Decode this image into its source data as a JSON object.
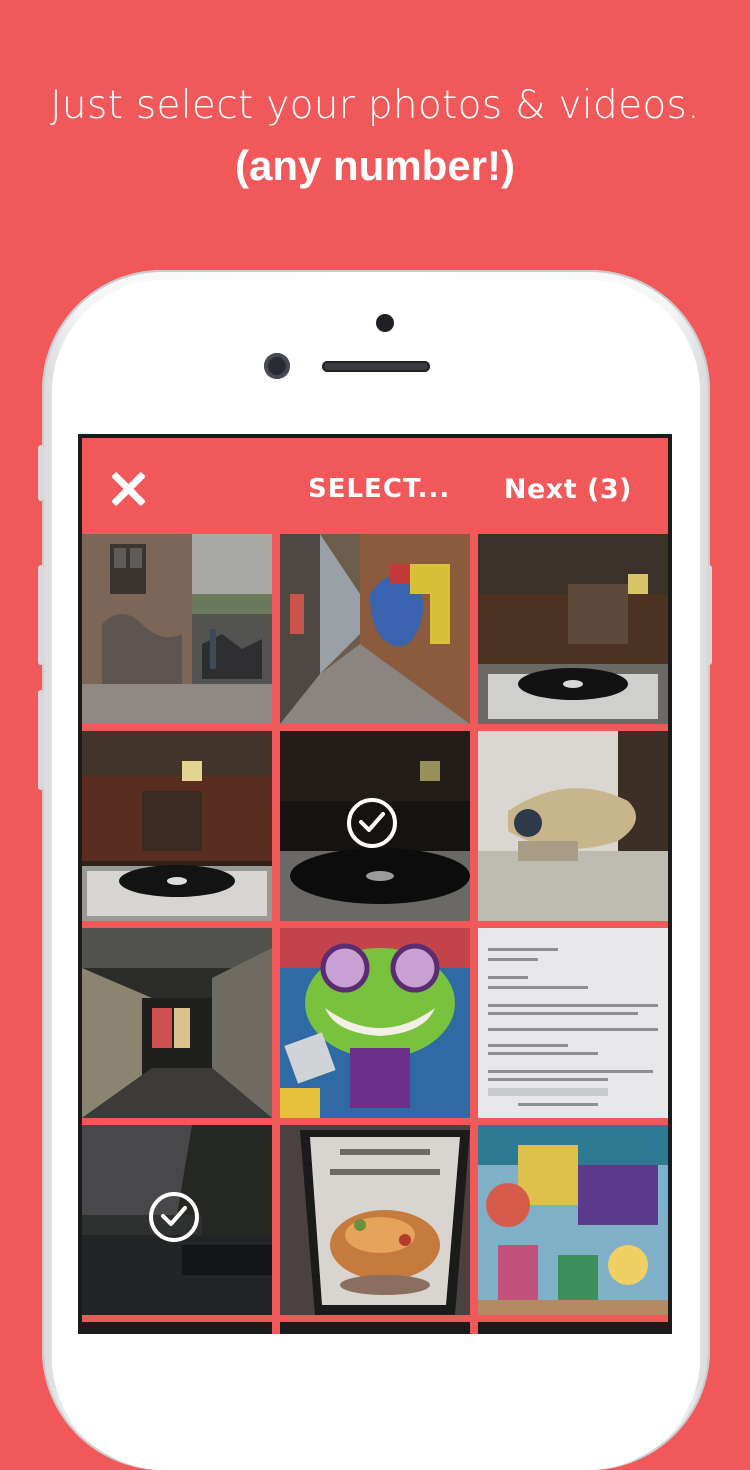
{
  "headline": {
    "line1": "Just select your photos & videos.",
    "line2": "(any number!)"
  },
  "colors": {
    "accent": "#f0585a",
    "text": "#ffffff"
  },
  "app": {
    "close_icon": "close-icon",
    "title": "SELECT...",
    "next_label": "Next (3)"
  },
  "photos": [
    {
      "subject": "brick alley with bicycles",
      "selected": false
    },
    {
      "subject": "graffiti alley",
      "selected": false
    },
    {
      "subject": "bar with turntable",
      "selected": false
    },
    {
      "subject": "bar interior with turntable",
      "selected": false
    },
    {
      "subject": "turntable close-up",
      "selected": true
    },
    {
      "subject": "millennium falcon model",
      "selected": false
    },
    {
      "subject": "underground arcade",
      "selected": false
    },
    {
      "subject": "green frog graffiti",
      "selected": false
    },
    {
      "subject": "screenshot of document",
      "selected": false
    },
    {
      "subject": "canal with boat",
      "selected": true
    },
    {
      "subject": "food poster",
      "selected": false
    },
    {
      "subject": "school mural",
      "selected": false
    }
  ]
}
